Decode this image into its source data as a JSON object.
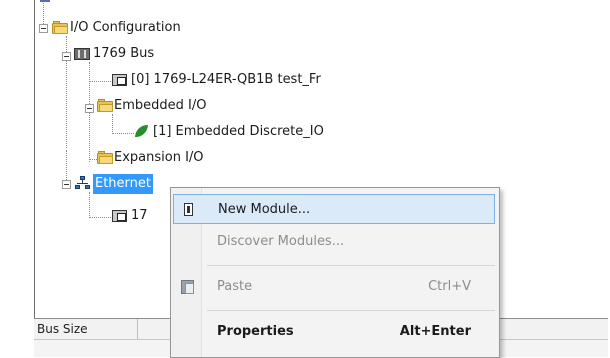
{
  "tree": {
    "io_configuration": "I/O Configuration",
    "bus": "1769 Bus",
    "controller": "[0] 1769-L24ER-QB1B test_Fr",
    "embedded_io": "Embedded I/O",
    "embedded_discrete": "[1] Embedded Discrete_IO",
    "expansion_io": "Expansion I/O",
    "ethernet": "Ethernet",
    "ethernet_child": "17"
  },
  "context_menu": {
    "items": [
      {
        "label": "New Module...",
        "shortcut": "",
        "state": "highlighted"
      },
      {
        "label": "Discover Modules...",
        "shortcut": "",
        "state": "disabled"
      },
      {
        "label": "Paste",
        "shortcut": "Ctrl+V",
        "state": "disabled"
      },
      {
        "label": "Properties",
        "shortcut": "Alt+Enter",
        "state": "bold"
      }
    ]
  },
  "bottom_grid": {
    "columns": [
      "Bus Size",
      ""
    ]
  },
  "colors": {
    "selection": "#3399ff",
    "menu_highlight": "#dbeaf9",
    "folder": "#e8c35a"
  }
}
